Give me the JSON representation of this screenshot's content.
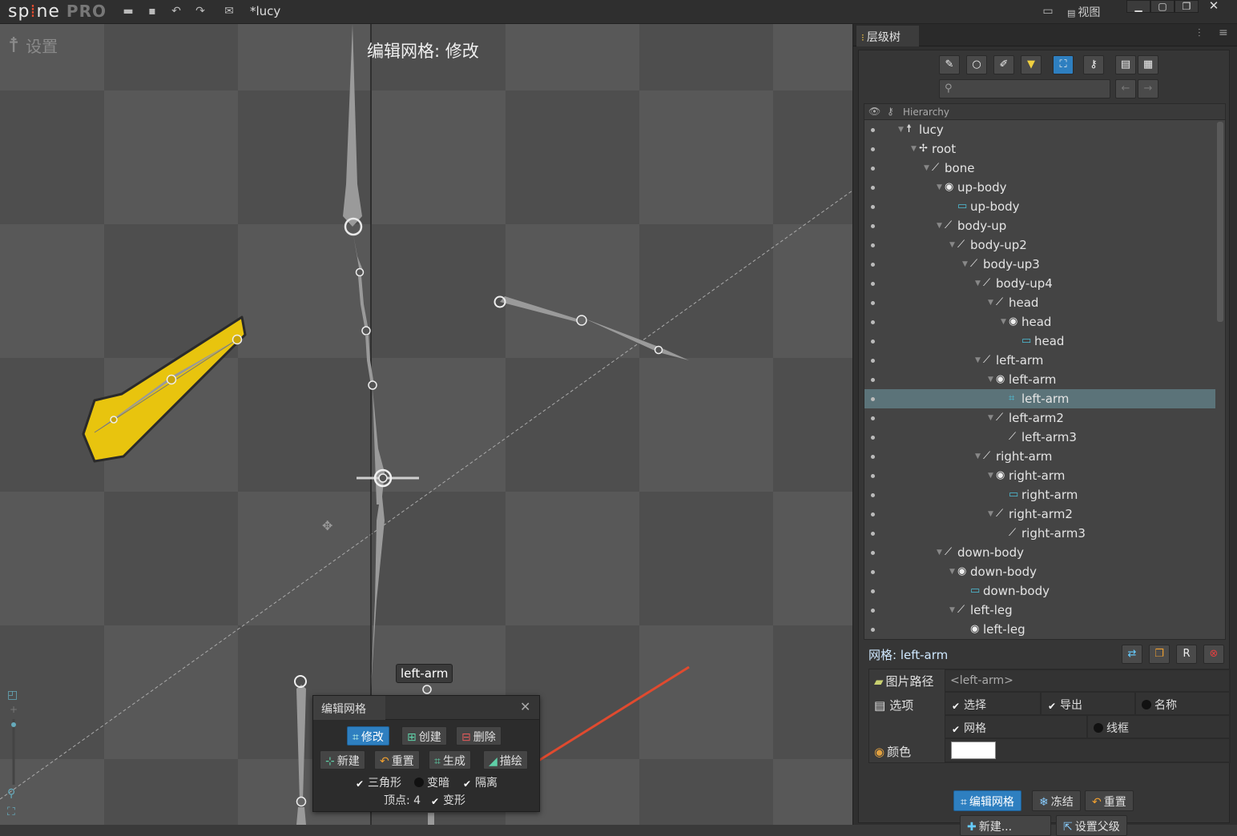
{
  "app": {
    "logo_a": "sp",
    "logo_b": "ne",
    "logo_pro": "PRO",
    "title": "*lucy",
    "view_menu": "视图"
  },
  "viewport": {
    "settings": "设置",
    "title": "编辑网格: 修改",
    "bone_label": "left-arm"
  },
  "mesh_panel": {
    "tab": "编辑网格",
    "modify": "修改",
    "create": "创建",
    "delete": "删除",
    "new": "新建",
    "reset": "重置",
    "generate": "生成",
    "trace": "描绘",
    "triangles": "三角形",
    "dim": "变暗",
    "isolate": "隔离",
    "vertices": "顶点: 4",
    "deform": "变形",
    "triangles_checked": true,
    "dim_checked": false,
    "isolate_checked": true,
    "deform_checked": true
  },
  "right_panel": {
    "tab": "层级树",
    "search_placeholder": "",
    "tree_header": "Hierarchy",
    "tree": [
      {
        "label": "lucy",
        "icon": "skeleton-icon",
        "depth": 0
      },
      {
        "label": "root",
        "icon": "root-icon",
        "depth": 1
      },
      {
        "label": "bone",
        "icon": "bone-icon",
        "depth": 2
      },
      {
        "label": "up-body",
        "icon": "slot-icon",
        "depth": 3
      },
      {
        "label": "up-body",
        "icon": "attachment-icon",
        "depth": 4
      },
      {
        "label": "body-up",
        "icon": "bone-icon",
        "depth": 3
      },
      {
        "label": "body-up2",
        "icon": "bone-icon",
        "depth": 4
      },
      {
        "label": "body-up3",
        "icon": "bone-icon",
        "depth": 5
      },
      {
        "label": "body-up4",
        "icon": "bone-icon",
        "depth": 6
      },
      {
        "label": "head",
        "icon": "bone-icon",
        "depth": 7
      },
      {
        "label": "head",
        "icon": "slot-icon",
        "depth": 8
      },
      {
        "label": "head",
        "icon": "attachment-icon",
        "depth": 9
      },
      {
        "label": "left-arm",
        "icon": "bone-icon",
        "depth": 6
      },
      {
        "label": "left-arm",
        "icon": "slot-icon",
        "depth": 7
      },
      {
        "label": "left-arm",
        "icon": "mesh-icon",
        "depth": 8,
        "selected": true
      },
      {
        "label": "left-arm2",
        "icon": "bone-icon",
        "depth": 7
      },
      {
        "label": "left-arm3",
        "icon": "bone-icon",
        "depth": 8
      },
      {
        "label": "right-arm",
        "icon": "bone-icon",
        "depth": 6
      },
      {
        "label": "right-arm",
        "icon": "slot-icon",
        "depth": 7
      },
      {
        "label": "right-arm",
        "icon": "attachment-icon",
        "depth": 8
      },
      {
        "label": "right-arm2",
        "icon": "bone-icon",
        "depth": 7
      },
      {
        "label": "right-arm3",
        "icon": "bone-icon",
        "depth": 8
      },
      {
        "label": "down-body",
        "icon": "bone-icon",
        "depth": 3
      },
      {
        "label": "down-body",
        "icon": "slot-icon",
        "depth": 4
      },
      {
        "label": "down-body",
        "icon": "attachment-icon",
        "depth": 5
      },
      {
        "label": "left-leg",
        "icon": "bone-icon",
        "depth": 4
      },
      {
        "label": "left-leg",
        "icon": "slot-icon",
        "depth": 5
      }
    ],
    "mesh_title": "网格: left-arm",
    "image_path_label": "图片路径",
    "image_path_value": "<left-arm>",
    "options_label": "选项",
    "opt_select": "选择",
    "opt_export": "导出",
    "opt_name": "名称",
    "opt_mesh": "网格",
    "opt_wireframe": "线框",
    "color_label": "颜色",
    "color_value": "#ffffff",
    "edit_mesh_btn": "编辑网格",
    "freeze_btn": "冻结",
    "reset_btn": "重置",
    "new_btn": "新建...",
    "set_parent_btn": "设置父级"
  },
  "colors": {
    "accent": "#2e7fc0",
    "selected_row": "#5b7379",
    "mesh_yellow": "#e8c40e"
  }
}
